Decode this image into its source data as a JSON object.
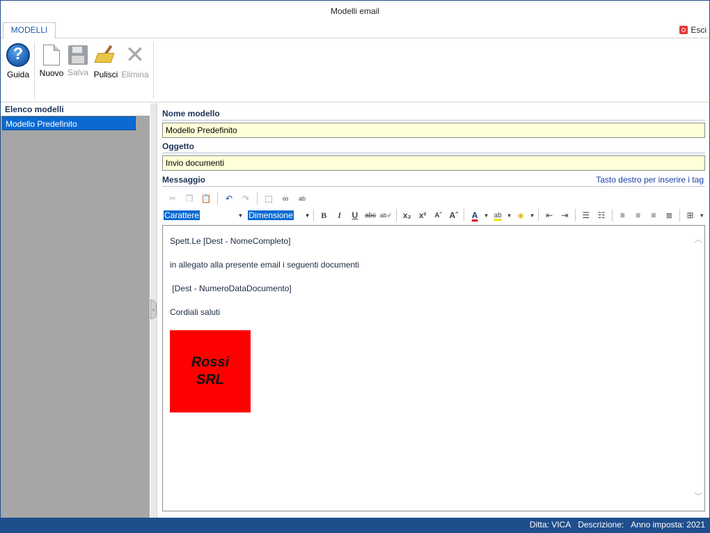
{
  "window": {
    "title": "Modelli email"
  },
  "tabs": {
    "active": "MODELLI",
    "exit_label": "Esci"
  },
  "ribbon": {
    "buttons": [
      {
        "label": "Guida",
        "icon": "help-icon",
        "enabled": true
      },
      {
        "label": "Nuovo",
        "icon": "new-document-icon",
        "enabled": true
      },
      {
        "label": "Salva",
        "icon": "save-disk-icon",
        "enabled": false
      },
      {
        "label": "Pulisci",
        "icon": "broom-icon",
        "enabled": true
      },
      {
        "label": "Elimina",
        "icon": "delete-x-icon",
        "enabled": false
      }
    ]
  },
  "sidebar": {
    "header": "Elenco modelli",
    "items": [
      {
        "label": "Modello Predefinito",
        "selected": true
      }
    ]
  },
  "form": {
    "name_label": "Nome modello",
    "name_value": "Modello Predefinito",
    "subject_label": "Oggetto",
    "subject_value": "Invio documenti",
    "message_label": "Messaggio",
    "tag_hint": "Tasto destro per inserire i tag"
  },
  "editor_toolbar": {
    "font_combo": "Carattere",
    "size_combo": "Dimensione"
  },
  "message": {
    "lines": [
      "Spett.Le [Dest - NomeCompleto]",
      "in allegato alla presente email i seguenti documenti",
      " [Dest - NumeroDataDocumento]",
      "Cordiali saluti"
    ],
    "logo": {
      "line1": "Rossi",
      "line2": "SRL",
      "background": "#ff0000"
    }
  },
  "status": {
    "ditta": "Ditta: VICA",
    "descrizione": "Descrizione:",
    "anno": "Anno imposta: 2021"
  },
  "colors": {
    "accent": "#0a6ad2",
    "statusbar": "#1f4e8c",
    "field_bg": "#ffffd8",
    "sidebar_bg": "#a6a6a6"
  }
}
